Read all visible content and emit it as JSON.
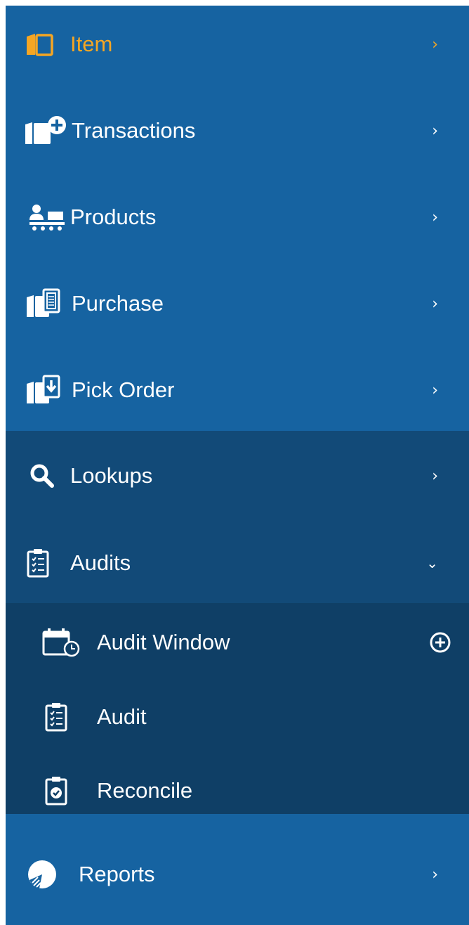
{
  "menu": {
    "item": {
      "label": "Item",
      "icon": "book-icon",
      "color": "#f5a623"
    },
    "transactions": {
      "label": "Transactions",
      "icon": "doc-plus-icon"
    },
    "products": {
      "label": "Products",
      "icon": "conveyor-icon"
    },
    "purchase": {
      "label": "Purchase",
      "icon": "doc-receipt-icon"
    },
    "pick_order": {
      "label": "Pick Order",
      "icon": "doc-download-icon"
    },
    "lookups": {
      "label": "Lookups",
      "icon": "search-icon"
    },
    "audits": {
      "label": "Audits",
      "icon": "clipboard-list-icon",
      "expanded": true
    },
    "audits_children": [
      {
        "label": "Audit Window",
        "icon": "calendar-clock-icon",
        "action_icon": "plus-circle-icon"
      },
      {
        "label": "Audit",
        "icon": "clipboard-list-icon"
      },
      {
        "label": "Reconcile",
        "icon": "clipboard-check-icon"
      }
    ],
    "reports": {
      "label": "Reports",
      "icon": "pie-chart-icon"
    }
  },
  "colors": {
    "sidebar_bg": "#1663a1",
    "section_bg": "#124a78",
    "submenu_bg": "#0f3f66",
    "active": "#f5a623",
    "text": "#ffffff"
  }
}
